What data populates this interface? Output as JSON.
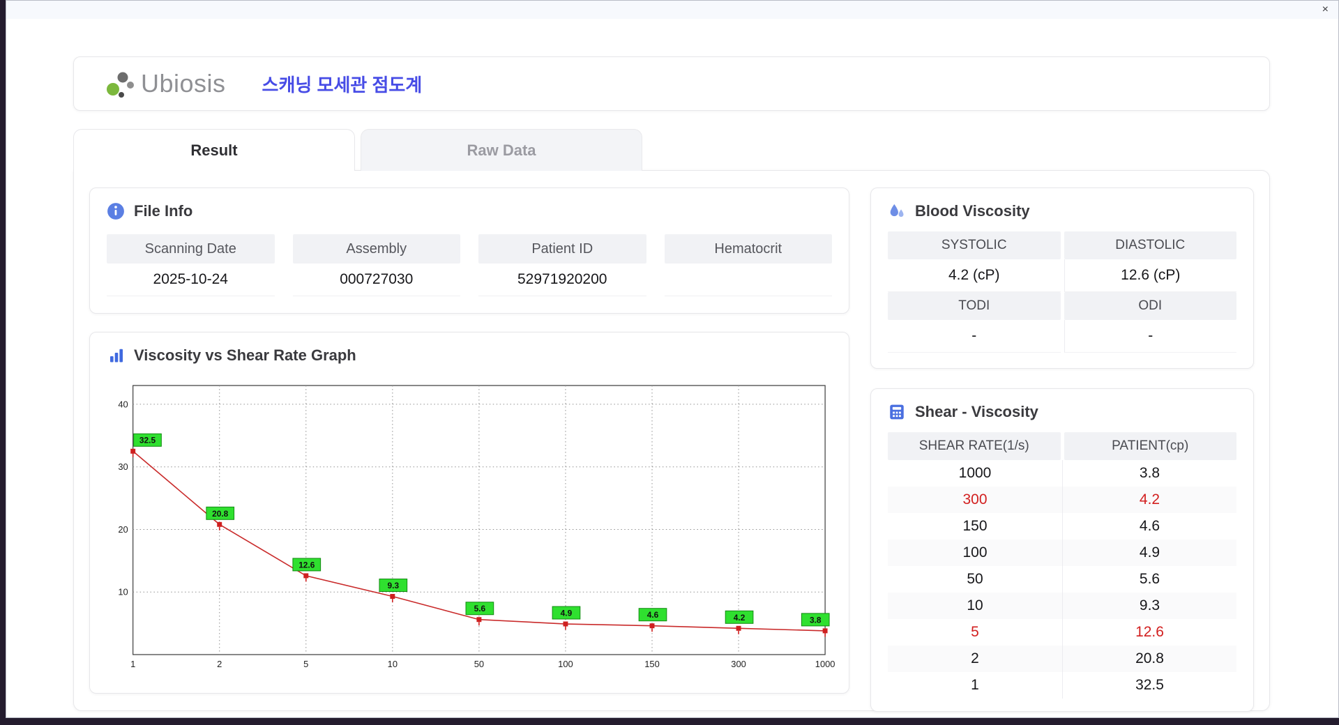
{
  "window": {
    "close_label": "×"
  },
  "header": {
    "logo_text": "Ubiosis",
    "title": "스캐닝 모세관 점도계"
  },
  "tabs": [
    {
      "label": "Result",
      "active": true
    },
    {
      "label": "Raw Data",
      "active": false
    }
  ],
  "file_info": {
    "section_title": "File Info",
    "fields": [
      {
        "label": "Scanning Date",
        "value": "2025-10-24"
      },
      {
        "label": "Assembly",
        "value": "000727030"
      },
      {
        "label": "Patient ID",
        "value": "52971920200"
      },
      {
        "label": "Hematocrit",
        "value": ""
      }
    ]
  },
  "graph": {
    "section_title": "Viscosity vs Shear Rate Graph"
  },
  "chart_data": {
    "type": "line",
    "title": "Viscosity vs Shear Rate Graph",
    "xlabel": "",
    "ylabel": "",
    "x_scale": "categorical",
    "x_labels": [
      "1",
      "2",
      "5",
      "10",
      "50",
      "100",
      "150",
      "300",
      "1000"
    ],
    "values": [
      32.5,
      20.8,
      12.6,
      9.3,
      5.6,
      4.9,
      4.6,
      4.2,
      3.8
    ],
    "y_ticks": [
      10,
      20,
      30,
      40
    ],
    "ylim": [
      0,
      43
    ],
    "grid": "dotted",
    "line_color": "#c92a2a",
    "marker_color": "#cf1f1f",
    "label_bg": "#2fe02f",
    "label_border": "#128a12",
    "legend": "none"
  },
  "blood_viscosity": {
    "section_title": "Blood Viscosity",
    "cells": [
      {
        "label": "SYSTOLIC",
        "value": "4.2 (cP)"
      },
      {
        "label": "DIASTOLIC",
        "value": "12.6 (cP)"
      },
      {
        "label": "TODI",
        "value": "-"
      },
      {
        "label": "ODI",
        "value": "-"
      }
    ]
  },
  "shear_viscosity": {
    "section_title": "Shear - Viscosity",
    "columns": [
      "SHEAR RATE(1/s)",
      "PATIENT(cp)"
    ],
    "rows": [
      {
        "rate": "1000",
        "value": "3.8",
        "highlight": false
      },
      {
        "rate": "300",
        "value": "4.2",
        "highlight": true
      },
      {
        "rate": "150",
        "value": "4.6",
        "highlight": false
      },
      {
        "rate": "100",
        "value": "4.9",
        "highlight": false
      },
      {
        "rate": "50",
        "value": "5.6",
        "highlight": false
      },
      {
        "rate": "10",
        "value": "9.3",
        "highlight": false
      },
      {
        "rate": "5",
        "value": "12.6",
        "highlight": true
      },
      {
        "rate": "2",
        "value": "20.8",
        "highlight": false
      },
      {
        "rate": "1",
        "value": "32.5",
        "highlight": false
      }
    ]
  },
  "colors": {
    "accent_blue": "#474ce6",
    "icon_blue": "#4a6fe0",
    "highlight_red": "#d21f1f",
    "table_header_bg": "#f1f2f5",
    "chart_label_green": "#2fe02f"
  }
}
